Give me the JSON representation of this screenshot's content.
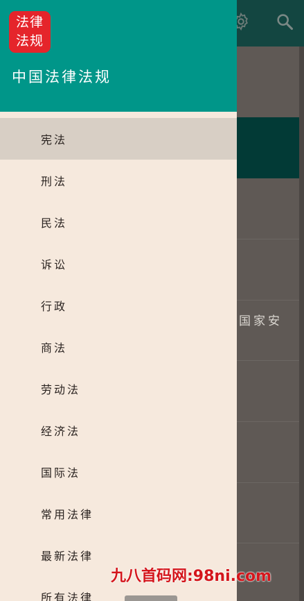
{
  "drawer": {
    "logo_line1": "法律",
    "logo_line2": "法规",
    "app_name": "中国法律法规",
    "items": [
      {
        "label": "宪法"
      },
      {
        "label": "刑法"
      },
      {
        "label": "民法"
      },
      {
        "label": "诉讼"
      },
      {
        "label": "行政"
      },
      {
        "label": "商法"
      },
      {
        "label": "劳动法"
      },
      {
        "label": "经济法"
      },
      {
        "label": "国际法"
      },
      {
        "label": "常用法律"
      },
      {
        "label": "最新法律"
      },
      {
        "label": "所有法律"
      }
    ],
    "selected_index": 0
  },
  "background": {
    "partial_text": "国家安",
    "icons": [
      "gear-icon",
      "search-icon"
    ]
  },
  "watermark": "九八首码网:98ni.com",
  "colors": {
    "drawer_header": "#009689",
    "drawer_bg": "#f6e9dd",
    "selected_item": "#d8cfc5",
    "logo_bg": "#e5252b",
    "watermark": "#d4161c"
  }
}
